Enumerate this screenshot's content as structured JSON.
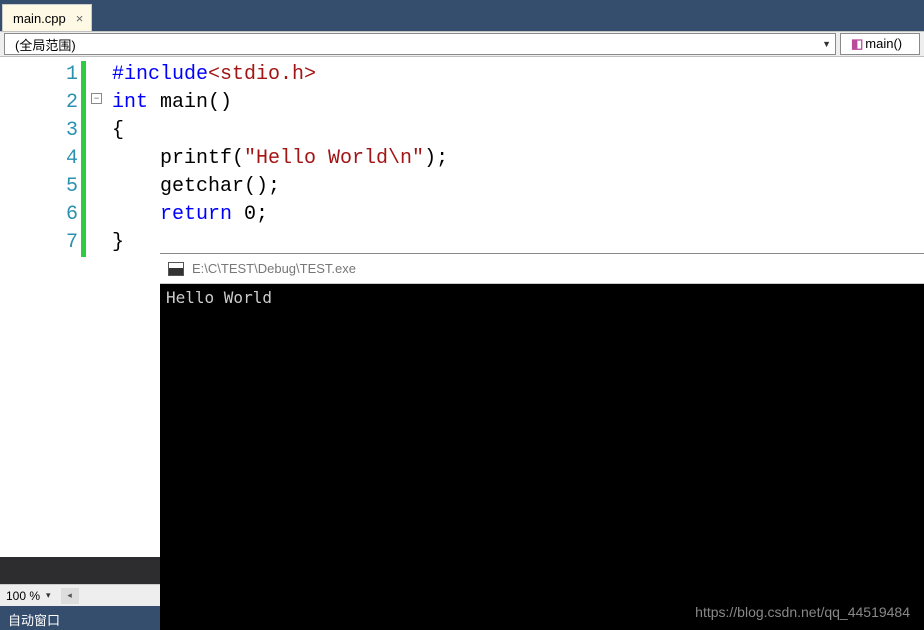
{
  "tab": {
    "name": "main.cpp",
    "close": "×"
  },
  "scope": {
    "label": "(全局范围)"
  },
  "fn": {
    "label": "main()"
  },
  "lines": [
    "1",
    "2",
    "3",
    "4",
    "5",
    "6",
    "7"
  ],
  "code": {
    "l1a": "#include",
    "l1b": "<stdio.h>",
    "l2a": "int",
    "l2b": " main()",
    "l3": "{",
    "l4a": "    printf(",
    "l4b": "\"Hello World\\n\"",
    "l4c": ");",
    "l5": "    getchar();",
    "l6a": "    ",
    "l6b": "return",
    "l6c": " 0;",
    "l7": "}"
  },
  "outline_glyph": "−",
  "zoom": {
    "level": "100 %",
    "arrow": "▾",
    "left": "◂"
  },
  "bottom_panel": {
    "title": "自动窗口"
  },
  "console": {
    "title": "E:\\C\\TEST\\Debug\\TEST.exe",
    "output": "Hello World"
  },
  "watermark": "https://blog.csdn.net/qq_44519484"
}
